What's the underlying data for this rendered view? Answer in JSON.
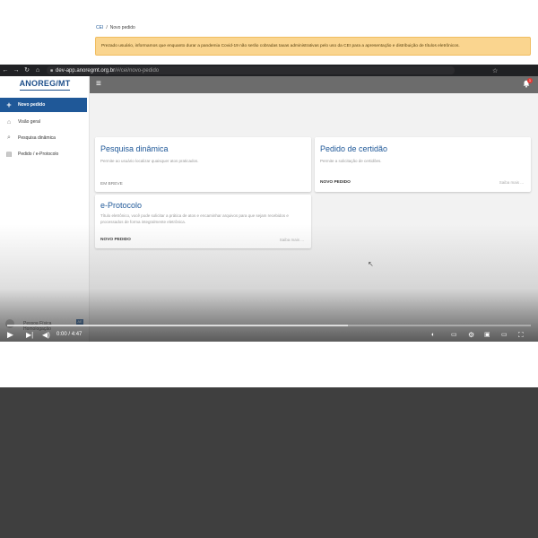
{
  "browser": {
    "url_host": "dev-app.anoregmt.org.br",
    "url_path": "/#/cei/novo-pedido"
  },
  "sidebar": {
    "logo": "ANOREG/MT",
    "items": [
      {
        "label": "Novo pedido",
        "icon": "plus-icon"
      },
      {
        "label": "Visão geral",
        "icon": "home-icon"
      },
      {
        "label": "Pesquisa dinâmica",
        "icon": "search-icon"
      },
      {
        "label": "Pedido / e-Protocolo",
        "icon": "document-icon"
      }
    ],
    "user": {
      "name": "Pessoa Física",
      "role": "Homologação",
      "badge": "AE"
    }
  },
  "topbar": {
    "notification_count": "1"
  },
  "breadcrumb": {
    "root": "CEI",
    "separator": "/",
    "current": "Novo pedido"
  },
  "alert": {
    "text": "Prezado usuário, informamos que enquanto durar a pandemia Covid-19 não serão cobradas taxas administrativas pelo uso da CEI para a apresentação e distribuição de títulos eletrônicos."
  },
  "cards": [
    {
      "title": "Pesquisa dinâmica",
      "description": "Permite ao usuário localizar quaisquer atos praticados.",
      "action": "EM BREVE",
      "link": ""
    },
    {
      "title": "Pedido de certidão",
      "description": "Permite a solicitação de certidões.",
      "action": "NOVO PEDIDO",
      "link": "Saiba mais ..."
    },
    {
      "title": "e-Protocolo",
      "description": "Título eletrônico, você pode solicitar a prática de atos e encaminhar arquivos para que sejam recebidos e processados de forma integralmente eletrônica.",
      "action": "NOVO PEDIDO",
      "link": "Saiba mais ..."
    }
  ],
  "video": {
    "current_time": "0:00",
    "separator": "/",
    "duration": "4:47",
    "buffered_fraction": 0.65,
    "played_fraction": 0.0
  },
  "colors": {
    "primary": "#1f5898",
    "alert_bg": "#fad58f",
    "topbar": "#6c6c6c",
    "badge": "#e53935"
  }
}
